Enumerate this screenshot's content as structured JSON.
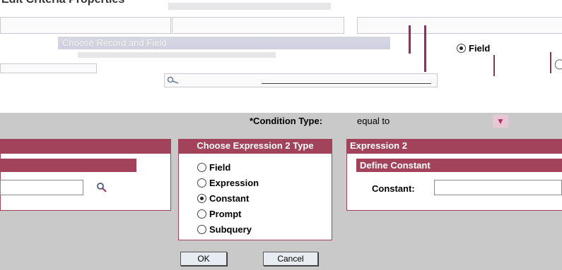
{
  "page": {
    "title": "Edit Criteria Properties"
  },
  "top_section": {
    "choose_record_field_header": "Choose Record and Field",
    "radio_field_label": "Field"
  },
  "condition": {
    "label": "*Condition Type:",
    "value": "equal to"
  },
  "expression2_type": {
    "header": "Choose Expression 2 Type",
    "options": [
      {
        "label": "Field",
        "checked": false
      },
      {
        "label": "Expression",
        "checked": false
      },
      {
        "label": "Constant",
        "checked": true
      },
      {
        "label": "Prompt",
        "checked": false
      },
      {
        "label": "Subquery",
        "checked": false
      }
    ]
  },
  "expression2": {
    "header": "Expression 2",
    "subheader": "Define Constant",
    "constant_label": "Constant:",
    "constant_value": ""
  },
  "buttons": {
    "ok": "OK",
    "cancel": "Cancel"
  },
  "icons": {
    "search": "search-icon",
    "dropdown": "chevron-down-icon"
  },
  "colors": {
    "header_bg": "#a2435b",
    "panel_bg": "#c9c9c9",
    "button_bg": "#e6ecf2"
  }
}
